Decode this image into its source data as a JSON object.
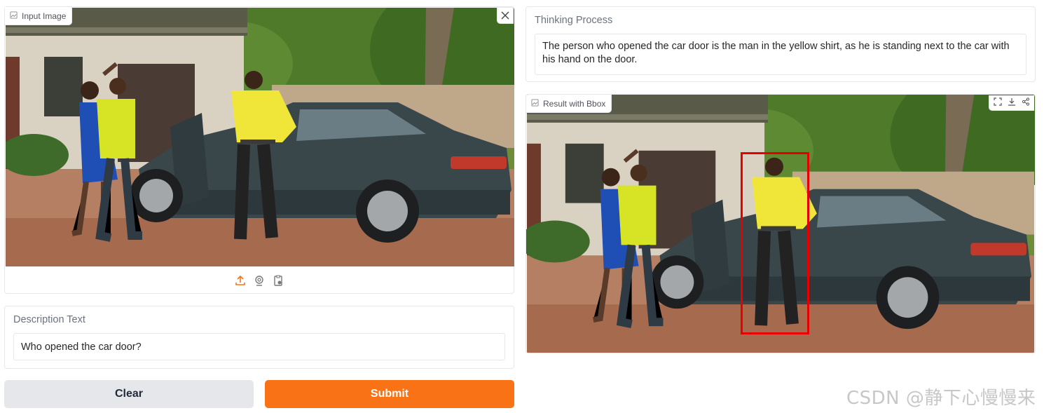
{
  "input_image": {
    "label": "Input Image",
    "icon": "image-icon",
    "close_icon": "close-icon",
    "sources": [
      "upload-icon",
      "webcam-icon",
      "clipboard-icon"
    ]
  },
  "description": {
    "label": "Description Text",
    "value": "Who opened the car door?"
  },
  "buttons": {
    "clear_label": "Clear",
    "submit_label": "Submit"
  },
  "thinking": {
    "label": "Thinking Process",
    "text": "The person who opened the car door is the man in the yellow shirt, as he is standing next to the car with his hand on the door."
  },
  "result": {
    "label": "Result with Bbox",
    "icon": "image-icon",
    "tools": [
      "fullscreen-icon",
      "download-icon",
      "share-icon"
    ],
    "bbox_color": "#e60000"
  },
  "watermark": "CSDN @静下心慢慢来",
  "colors": {
    "accent": "#f97316",
    "secondary_button": "#e5e7eb",
    "border": "#e5e7eb"
  }
}
